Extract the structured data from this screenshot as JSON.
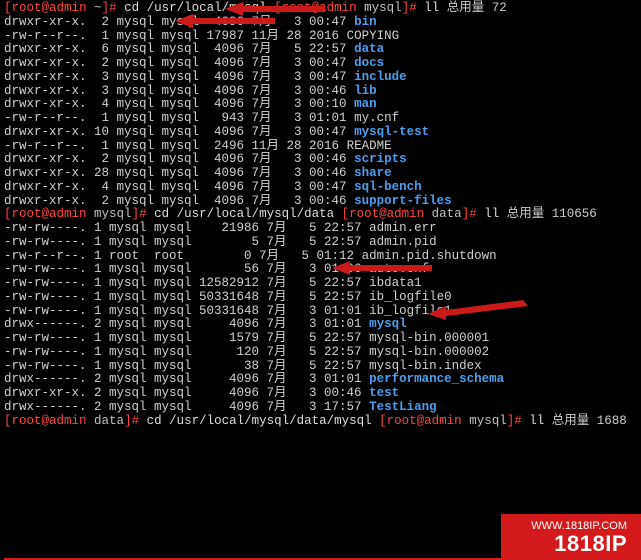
{
  "prompts": {
    "p1": {
      "user": "root",
      "host": "admin",
      "path": "~",
      "cmd": "cd /usr/local/mysql"
    },
    "p2": {
      "user": "root",
      "host": "admin",
      "path": "mysql",
      "cmd": "ll"
    },
    "p3": {
      "user": "root",
      "host": "admin",
      "path": "mysql",
      "cmd": "cd /usr/local/mysql/data"
    },
    "p4": {
      "user": "root",
      "host": "admin",
      "path": "data",
      "cmd": "ll"
    },
    "p5": {
      "user": "root",
      "host": "admin",
      "path": "data",
      "cmd": "cd /usr/local/mysql/data/mysql"
    },
    "p6": {
      "user": "root",
      "host": "admin",
      "path": "mysql",
      "cmd": "ll"
    }
  },
  "totals": {
    "t1": "总用量 72",
    "t2": "总用量 110656",
    "t3": "总用量 1688"
  },
  "list1": [
    {
      "perm": "drwxr-xr-x.",
      "ln": "2",
      "own": "mysql mysql",
      "size": "4096",
      "date": "7月   3 00:47",
      "name": "bin",
      "cls": "dir"
    },
    {
      "perm": "-rw-r--r--.",
      "ln": "1",
      "own": "mysql mysql",
      "size": "17987",
      "date": "11月 28 2016",
      "name": "COPYING",
      "cls": "file"
    },
    {
      "perm": "drwxr-xr-x.",
      "ln": "6",
      "own": "mysql mysql",
      "size": "4096",
      "date": "7月   5 22:57",
      "name": "data",
      "cls": "dir"
    },
    {
      "perm": "drwxr-xr-x.",
      "ln": "2",
      "own": "mysql mysql",
      "size": "4096",
      "date": "7月   3 00:47",
      "name": "docs",
      "cls": "dir"
    },
    {
      "perm": "drwxr-xr-x.",
      "ln": "3",
      "own": "mysql mysql",
      "size": "4096",
      "date": "7月   3 00:47",
      "name": "include",
      "cls": "dir"
    },
    {
      "perm": "drwxr-xr-x.",
      "ln": "3",
      "own": "mysql mysql",
      "size": "4096",
      "date": "7月   3 00:46",
      "name": "lib",
      "cls": "dir"
    },
    {
      "perm": "drwxr-xr-x.",
      "ln": "4",
      "own": "mysql mysql",
      "size": "4096",
      "date": "7月   3 00:10",
      "name": "man",
      "cls": "dir"
    },
    {
      "perm": "-rw-r--r--.",
      "ln": "1",
      "own": "mysql mysql",
      "size": "943",
      "date": "7月   3 01:01",
      "name": "my.cnf",
      "cls": "file"
    },
    {
      "perm": "drwxr-xr-x.",
      "ln": "10",
      "own": "mysql mysql",
      "size": "4096",
      "date": "7月   3 00:47",
      "name": "mysql-test",
      "cls": "dir"
    },
    {
      "perm": "-rw-r--r--.",
      "ln": "1",
      "own": "mysql mysql",
      "size": "2496",
      "date": "11月 28 2016",
      "name": "README",
      "cls": "file"
    },
    {
      "perm": "drwxr-xr-x.",
      "ln": "2",
      "own": "mysql mysql",
      "size": "4096",
      "date": "7月   3 00:46",
      "name": "scripts",
      "cls": "dir"
    },
    {
      "perm": "drwxr-xr-x.",
      "ln": "28",
      "own": "mysql mysql",
      "size": "4096",
      "date": "7月   3 00:46",
      "name": "share",
      "cls": "dir"
    },
    {
      "perm": "drwxr-xr-x.",
      "ln": "4",
      "own": "mysql mysql",
      "size": "4096",
      "date": "7月   3 00:47",
      "name": "sql-bench",
      "cls": "dir"
    },
    {
      "perm": "drwxr-xr-x.",
      "ln": "2",
      "own": "mysql mysql",
      "size": "4096",
      "date": "7月   3 00:46",
      "name": "support-files",
      "cls": "dir"
    }
  ],
  "list2": [
    {
      "perm": "-rw-rw----.",
      "ln": "1",
      "own": "mysql mysql",
      "size": "21986",
      "date": "7月   5 22:57",
      "name": "admin.err",
      "cls": "file"
    },
    {
      "perm": "-rw-rw----.",
      "ln": "1",
      "own": "mysql mysql",
      "size": "5",
      "date": "7月   5 22:57",
      "name": "admin.pid",
      "cls": "file"
    },
    {
      "perm": "-rw-r--r--.",
      "ln": "1",
      "own": "root  root",
      "size": "0",
      "date": "7月   5 01:12",
      "name": "admin.pid.shutdown",
      "cls": "file"
    },
    {
      "perm": "-rw-rw----.",
      "ln": "1",
      "own": "mysql mysql",
      "size": "56",
      "date": "7月   3 01:06",
      "name": "auto.cnf",
      "cls": "file"
    },
    {
      "perm": "-rw-rw----.",
      "ln": "1",
      "own": "mysql mysql",
      "size": "12582912",
      "date": "7月   5 22:57",
      "name": "ibdata1",
      "cls": "file"
    },
    {
      "perm": "-rw-rw----.",
      "ln": "1",
      "own": "mysql mysql",
      "size": "50331648",
      "date": "7月   5 22:57",
      "name": "ib_logfile0",
      "cls": "file"
    },
    {
      "perm": "-rw-rw----.",
      "ln": "1",
      "own": "mysql mysql",
      "size": "50331648",
      "date": "7月   3 01:01",
      "name": "ib_logfile1",
      "cls": "file"
    },
    {
      "perm": "drwx------.",
      "ln": "2",
      "own": "mysql mysql",
      "size": "4096",
      "date": "7月   3 01:01",
      "name": "mysql",
      "cls": "dir"
    },
    {
      "perm": "-rw-rw----.",
      "ln": "1",
      "own": "mysql mysql",
      "size": "1579",
      "date": "7月   5 22:57",
      "name": "mysql-bin.000001",
      "cls": "file"
    },
    {
      "perm": "-rw-rw----.",
      "ln": "1",
      "own": "mysql mysql",
      "size": "120",
      "date": "7月   5 22:57",
      "name": "mysql-bin.000002",
      "cls": "file"
    },
    {
      "perm": "-rw-rw----.",
      "ln": "1",
      "own": "mysql mysql",
      "size": "38",
      "date": "7月   5 22:57",
      "name": "mysql-bin.index",
      "cls": "file"
    },
    {
      "perm": "drwx------.",
      "ln": "2",
      "own": "mysql mysql",
      "size": "4096",
      "date": "7月   3 01:01",
      "name": "performance_schema",
      "cls": "dir"
    },
    {
      "perm": "drwxr-xr-x.",
      "ln": "2",
      "own": "mysql mysql",
      "size": "4096",
      "date": "7月   3 00:46",
      "name": "test",
      "cls": "dir"
    },
    {
      "perm": "drwx------.",
      "ln": "2",
      "own": "mysql mysql",
      "size": "4096",
      "date": "7月   3 17:57",
      "name": "TestLiang",
      "cls": "dir"
    }
  ],
  "watermark": {
    "url": "WWW.1818IP.COM",
    "brand": "1818IP"
  }
}
